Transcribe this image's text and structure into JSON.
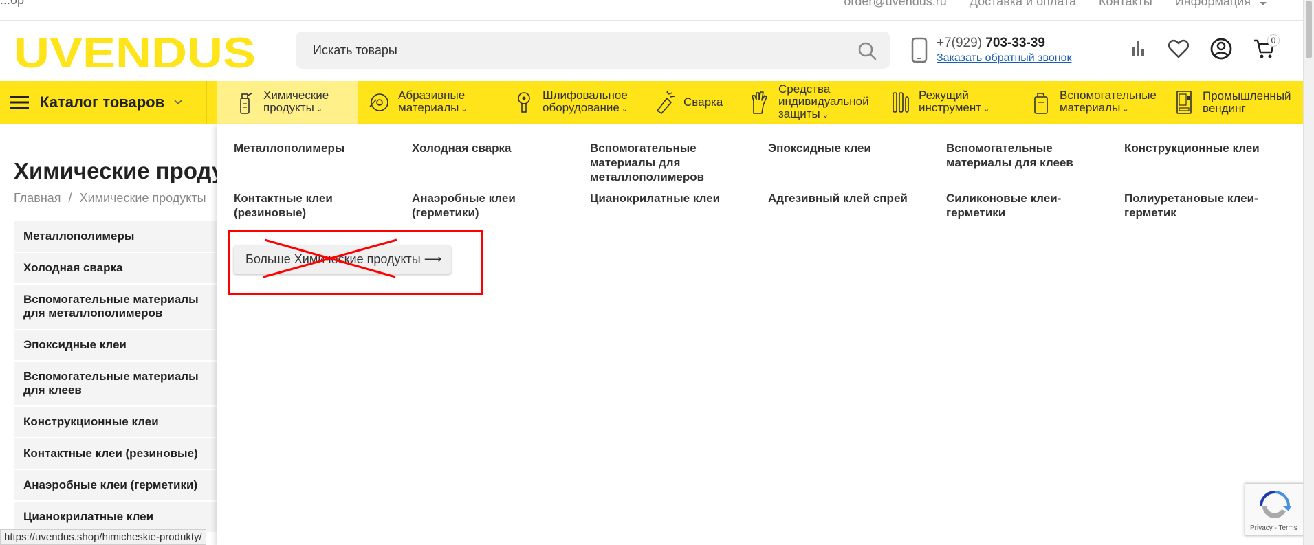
{
  "topbar": {
    "left_text": "...ор",
    "email": "order@uvendus.ru",
    "links": [
      "Доставка и оплата",
      "Контакты",
      "Информация"
    ]
  },
  "header": {
    "logo_text": "UVENDUS",
    "search_placeholder": "Искать товары",
    "phone_prefix": "+7(929) ",
    "phone_main": "703-33-39",
    "callback_label": "Заказать обратный звонок",
    "cart_count": "0"
  },
  "nav": {
    "catalog_label": "Каталог товаров",
    "items": [
      {
        "label_1": "Химические",
        "label_2": "продукты",
        "has_caret": true,
        "icon": "spray-bottle-icon"
      },
      {
        "label_1": "Абразивные",
        "label_2": "материалы",
        "has_caret": true,
        "icon": "grinding-disc-icon"
      },
      {
        "label_1": "Шлифовальное",
        "label_2": "оборудование",
        "has_caret": true,
        "icon": "grinder-icon"
      },
      {
        "label_1": "Сварка",
        "label_2": "",
        "has_caret": false,
        "icon": "welding-icon"
      },
      {
        "label_1": "Средства",
        "label_2": "индивидуальной",
        "label_3": "защиты",
        "has_caret": true,
        "icon": "gloves-icon"
      },
      {
        "label_1": "Режущий",
        "label_2": "инструмент",
        "has_caret": true,
        "icon": "cutting-tool-icon"
      },
      {
        "label_1": "Вспомогательные",
        "label_2": "материалы",
        "has_caret": true,
        "icon": "canister-icon"
      },
      {
        "label_1": "Промышленный",
        "label_2": "вендинг",
        "has_caret": false,
        "icon": "vending-machine-icon"
      }
    ]
  },
  "page": {
    "title": "Химические продукты",
    "breadcrumb_home": "Главная",
    "breadcrumb_sep": "/",
    "breadcrumb_current": "Химические продукты"
  },
  "sidebar": {
    "items": [
      "Металлополимеры",
      "Холодная сварка",
      "Вспомогательные материалы для металлополимеров",
      "Эпоксидные клеи",
      "Вспомогательные материалы для клеев",
      "Конструкционные клеи",
      "Контактные клеи (резиновые)",
      "Анаэробные клеи (герметики)",
      "Цианокрилатные клеи"
    ]
  },
  "dropdown": {
    "links": [
      "Металлополимеры",
      "Холодная сварка",
      "Вспомогательные материалы для металлополимеров",
      "Эпоксидные клеи",
      "Вспомогательные материалы для клеев",
      "Конструкционные клеи",
      "Контактные клеи (резиновые)",
      "Анаэробные клеи (герметики)",
      "Цианокрилатные клеи",
      "Адгезивный клей спрей",
      "Силиконовые клеи-герметики",
      "Полиуретановые клеи-герметик"
    ],
    "more_button": "Больше Химические продукты ⟶"
  },
  "statusbar": {
    "url": "https://uvendus.shop/himicheskie-produkty/"
  },
  "recaptcha": {
    "terms": "Privacy - Terms"
  },
  "colors": {
    "brand_yellow": "#ffe41a",
    "active_nav": "#fff08a",
    "annotation_red": "#ff0000",
    "link_blue": "#1a5fb4"
  }
}
